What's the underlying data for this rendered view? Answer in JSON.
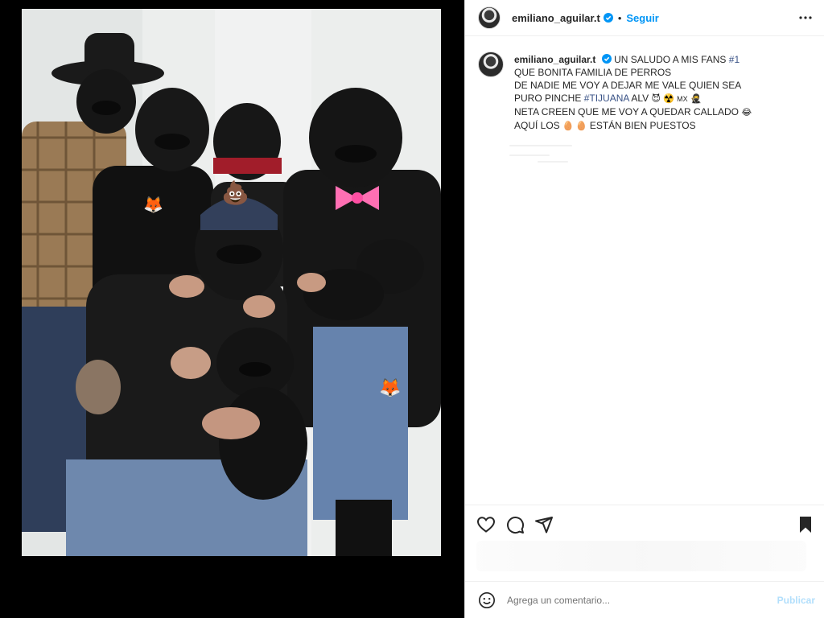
{
  "post": {
    "username": "emiliano_aguilar.t",
    "dot": "•",
    "follow_label": "Seguir"
  },
  "caption": {
    "username": "emiliano_aguilar.t",
    "line1_text": "UN SALUDO A MIS FANS",
    "line1_hashtag": "#1",
    "line2": "QUE BONITA FAMILIA DE PERROS",
    "line3": "DE NADIE ME VOY A DEJAR ME VALE QUIEN SEA",
    "line4_text": "PURO PINCHE",
    "line4_hashtag": "#TIJUANA",
    "line4_after": "ALV",
    "line4_emoji": "😈 ☢️",
    "line4_mx": "MX",
    "line4_emoji2": "🥷",
    "line5": "NETA CREEN QUE ME VOY A QUEDAR CALLADO",
    "line5_emoji": "😂",
    "line6_before": "AQUÍ LOS",
    "line6_emoji": "🥚 🥚",
    "line6_after": "ESTÁN BIEN PUESTOS"
  },
  "comment": {
    "placeholder": "Agrega un comentario...",
    "publish_label": "Publicar"
  },
  "photo": {
    "emoji_poop": "💩",
    "emoji_fox": "🦊"
  },
  "colors": {
    "link_blue": "#0095f6",
    "hashtag": "#385185",
    "publish_disabled": "#b2dffc"
  },
  "icons": {
    "more": "more-horizontal-icon",
    "like": "heart-icon",
    "comment": "comment-icon",
    "share": "share-icon",
    "save": "bookmark-icon",
    "emoji": "emoji-icon",
    "verified": "verified-badge-icon"
  }
}
